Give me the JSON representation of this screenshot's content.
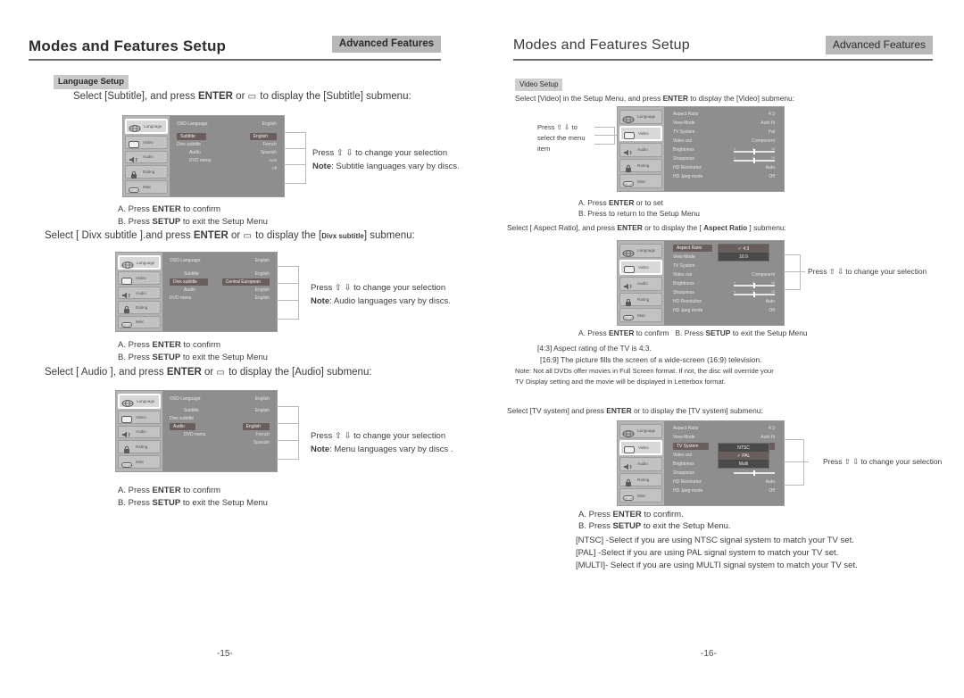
{
  "doc": {
    "left_page_number": "-15-",
    "right_page_number": "-16-"
  },
  "left": {
    "header": {
      "title": "Modes and Features Setup",
      "tag": "Advanced Features"
    },
    "section_tag": "Language Setup",
    "intro": {
      "a": "Select [Subtitle], and press ",
      "enter": "ENTER",
      "b": " or ",
      "arrow": "▭",
      "c": " to display the [Subtitle] submenu:"
    },
    "osd1": {
      "tabs": [
        {
          "label": "Language",
          "icon": "globe-icon",
          "selected": true
        },
        {
          "label": "Video",
          "icon": "tv-icon",
          "selected": false
        },
        {
          "label": "Audio",
          "icon": "speaker-icon",
          "selected": false
        },
        {
          "label": "Rating",
          "icon": "lock-icon",
          "selected": false
        },
        {
          "label": "Misc",
          "icon": "setup-icon",
          "selected": false
        }
      ],
      "rows": [
        {
          "key": "OSD Language",
          "value": "English",
          "highlight": false
        },
        {
          "key": "Subtitle",
          "value": "English",
          "highlight": true
        },
        {
          "key": "Divx subtitle",
          "value": "French",
          "highlight": false
        },
        {
          "key": "Audio",
          "value": "Spanish",
          "highlight": false
        },
        {
          "key": "DVD menu",
          "value": "Auto",
          "highlight": false
        },
        {
          "key": "",
          "value": "Off",
          "highlight": false
        }
      ],
      "note_press": "Press ⇧ ⇩ to change your selection",
      "note_label": "Note",
      "note_text": ": Subtitle languages vary by discs."
    },
    "steps1": {
      "a": "A.  Press ",
      "a_key": "ENTER",
      "a_tail": " to confirm",
      "b": "B.  Press ",
      "b_key": "SETUP",
      "b_tail": " to exit the Setup Menu"
    },
    "intro2": {
      "a": "Select [ Divx subtitle ].and press ",
      "enter": "ENTER",
      "b": " or ",
      "c": " to display the [",
      "target": "Divx subtitle",
      "d": "] submenu:"
    },
    "osd2": {
      "rows": [
        {
          "key": "OSD Language",
          "value": "English",
          "highlight": false
        },
        {
          "key": "Subtitle",
          "value": "English",
          "highlight": false
        },
        {
          "key": "Divx subtitle",
          "value": "Central European",
          "highlight": true
        },
        {
          "key": "Audio",
          "value": "English",
          "highlight": false
        },
        {
          "key": "DVD menu",
          "value": "English",
          "highlight": false
        }
      ],
      "note_press": "Press ⇧ ⇩ to change your selection",
      "note_label": "Note",
      "note_text": ": Audio languages vary by discs."
    },
    "intro3": {
      "a": "Select [ Audio ], and press ",
      "enter": "ENTER",
      "b": " or ",
      "c": " to display the [Audio] submenu:"
    },
    "osd3": {
      "rows": [
        {
          "key": "OSD Language",
          "value": "English",
          "highlight": false
        },
        {
          "key": "Subtitle",
          "value": "English",
          "highlight": false
        },
        {
          "key": "Divx subtitle",
          "value": "",
          "highlight": false
        },
        {
          "key": "Audio",
          "value": "English",
          "highlight": true
        },
        {
          "key": "DVD menu",
          "value": "French",
          "highlight": false
        },
        {
          "key": "",
          "value": "Spanish",
          "highlight": false
        }
      ],
      "note_press": "Press ⇧ ⇩ to change your selection",
      "note_label": "Note",
      "note_text": ": Menu languages vary by discs ."
    }
  },
  "right": {
    "header": {
      "title": "Modes and Features Setup",
      "tag": "Advanced Features"
    },
    "section_tag": "Video Setup",
    "intro": {
      "a": "Select [Video] in the Setup Menu, and press ",
      "enter": "ENTER",
      "b": " to display the [Video] submenu:"
    },
    "side_note": {
      "l1": "Press ⇧ ⇩ to",
      "l2": "select the menu",
      "l3": "item"
    },
    "osd_video": {
      "tabs": [
        {
          "label": "Language",
          "icon": "globe-icon",
          "selected": false
        },
        {
          "label": "Video",
          "icon": "tv-icon",
          "selected": true
        },
        {
          "label": "Audio",
          "icon": "speaker-icon",
          "selected": false
        },
        {
          "label": "Rating",
          "icon": "lock-icon",
          "selected": false
        },
        {
          "label": "Misc",
          "icon": "setup-icon",
          "selected": false
        }
      ],
      "rows": [
        {
          "key": "Aspect Ratio",
          "value": "4:3"
        },
        {
          "key": "View Mode",
          "value": "Auto fit"
        },
        {
          "key": "TV System",
          "value": "Pal"
        },
        {
          "key": "Video out",
          "value": "Component"
        },
        {
          "key": "Brightness",
          "value": "slider"
        },
        {
          "key": "Sharpness",
          "value": "slider"
        },
        {
          "key": "HD Resolution",
          "value": "Auto"
        },
        {
          "key": "HD Jpeg mode",
          "value": "Off"
        }
      ],
      "scale_min": "1",
      "scale_mid": "8",
      "scale_max": "16"
    },
    "steps_video": {
      "a": "A.  Press  ",
      "a_key": "ENTER",
      "a_tail": " or      to set",
      "b": "B.  Press        to return to the Setup Menu"
    },
    "intro_aspect": {
      "a": "Select [ Aspect Ratio], and press ",
      "enter": "ENTER",
      "b": " or      to display the [ ",
      "target": "Aspect Ratio",
      "c": "  ] submenu:"
    },
    "osd_aspect": {
      "highlight_key": "Aspect Ratio",
      "options": [
        {
          "label": "4:3",
          "checked": true
        },
        {
          "label": "16:9",
          "checked": false
        }
      ],
      "note_press": "Press ⇧ ⇩ to change your selection"
    },
    "steps_aspect": {
      "a": "A.  Press ",
      "a_key": "ENTER",
      "a_tail": " to confirm",
      "b": "B.  Press ",
      "b_key": "SETUP",
      "b_tail": " to exit the Setup Menu"
    },
    "aspect_notes": {
      "l1": "[4:3] Aspect rating of the TV is 4:3.",
      "l2": "[16:9] The picture fills the screen of a wide-screen (16:9) television.",
      "l3": "Note: Not all DVDs offer movies in Full Screen format. If not, the disc will override your",
      "l4": "TV Display setting and the movie will be displayed in Letterbox format."
    },
    "intro_tv": {
      "a": "Select [TV system] and press ",
      "enter": "ENTER",
      "b": " or      to display the [TV system] submenu:"
    },
    "osd_tv": {
      "highlight_key": "TV System",
      "highlight_value": "NTSC",
      "options": [
        {
          "label": "NTSC",
          "checked": false
        },
        {
          "label": "PAL",
          "checked": true
        },
        {
          "label": "Multi",
          "checked": false
        }
      ],
      "note_press": "Press ⇧ ⇩ to change your selection"
    },
    "steps_tv": {
      "a": "A.  Press  ",
      "a_key": "ENTER",
      "a_tail": "  to confirm.",
      "b": "B.  Press  ",
      "b_key": "SETUP",
      "b_tail": " to exit the Setup Menu."
    },
    "tv_notes": {
      "l1": "[NTSC] -Select if you are using NTSC signal system to match your TV set.",
      "l2": "[PAL] -Select if  you are using PAL signal system to match your TV set.",
      "l3": "[MULTI]- Select if you are using MULTI signal system to match your TV set."
    }
  }
}
